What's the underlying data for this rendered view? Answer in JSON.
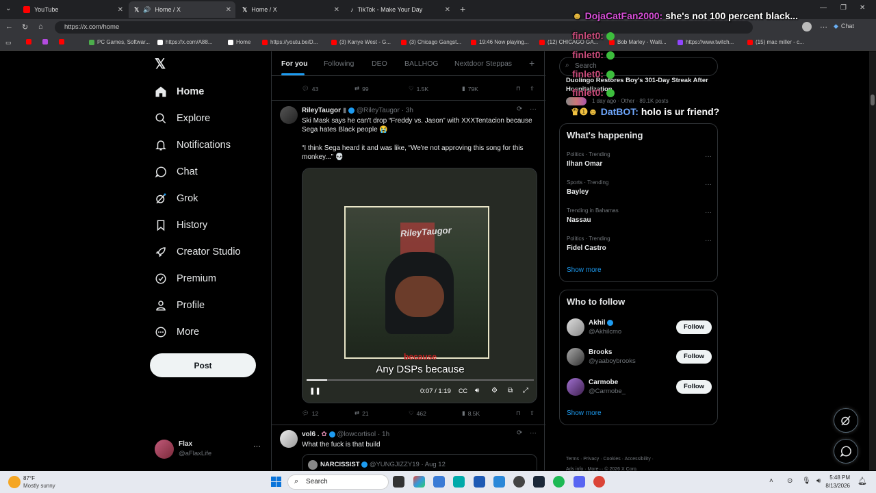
{
  "browser": {
    "tabs": [
      {
        "title": "YouTube",
        "color": "#ff0000"
      },
      {
        "title": "Home / X",
        "color": "#ffffff"
      },
      {
        "title": "Home / X",
        "color": "#ffffff"
      },
      {
        "title": "TikTok - Make Your Day",
        "color": "#ffffff"
      }
    ],
    "url": "https://x.com/home",
    "bookmarks": [
      {
        "label": "",
        "color": "#ff0000"
      },
      {
        "label": "",
        "color": "#b44be0"
      },
      {
        "label": "",
        "color": "#ff0000"
      },
      {
        "label": "PC Games, Softwar...",
        "color": "#4cae4c"
      },
      {
        "label": "https://x.com/A88...",
        "color": "#ffffff"
      },
      {
        "label": "Home",
        "color": "#ffffff"
      },
      {
        "label": "https://youtu.be/D...",
        "color": "#ff0000"
      },
      {
        "label": "(3) Kanye West - G...",
        "color": "#ff0000"
      },
      {
        "label": "(3) Chicago Gangst...",
        "color": "#ff0000"
      },
      {
        "label": "19:46 Now playing...",
        "color": "#ff0000"
      },
      {
        "label": "(12) CHICAGO GA...",
        "color": "#ff0000"
      },
      {
        "label": "Bob Marley - Waiti...",
        "color": "#ff0000"
      },
      {
        "label": "https://www.twitch...",
        "color": "#9146ff"
      },
      {
        "label": "(15) mac miller - c...",
        "color": "#ff0000"
      }
    ],
    "chat_label": "Chat"
  },
  "nav": {
    "items": [
      {
        "label": "Home",
        "icon": "home-icon"
      },
      {
        "label": "Explore",
        "icon": "search-icon"
      },
      {
        "label": "Notifications",
        "icon": "bell-icon"
      },
      {
        "label": "Chat",
        "icon": "chat-icon"
      },
      {
        "label": "Grok",
        "icon": "grok-icon"
      },
      {
        "label": "History",
        "icon": "bookmark-icon"
      },
      {
        "label": "Creator Studio",
        "icon": "rocket-icon"
      },
      {
        "label": "Premium",
        "icon": "verified-icon"
      },
      {
        "label": "Profile",
        "icon": "person-icon"
      },
      {
        "label": "More",
        "icon": "more-circle-icon"
      }
    ],
    "post_label": "Post",
    "profile": {
      "name": "Flax",
      "handle": "@aFlaxLife"
    }
  },
  "feed": {
    "tabs": [
      "For you",
      "Following",
      "DEO",
      "BALLHOG",
      "Nextdoor Steppas"
    ],
    "prev_actions": {
      "replies": "43",
      "reposts": "99",
      "likes": "1.5K",
      "views": "79K"
    },
    "tweet1": {
      "name": "RileyTaugor",
      "handle": "@RileyTaugor",
      "time": "· 3h",
      "text1": "Ski Mask says he can't drop “Freddy vs. Jason” with XXXTentacion because Sega hates Black people 😭",
      "text2": "“I think Sega heard it and was like, “We're not approving this song for this monkey...” 💀",
      "video": {
        "watermark": "RileyTaugor",
        "caption_red": "because",
        "caption": "Any DSPs because",
        "time": "0:07 / 1:19",
        "progress": 0.09
      },
      "actions": {
        "replies": "12",
        "reposts": "21",
        "likes": "462",
        "views": "8.5K"
      }
    },
    "tweet2": {
      "name": "vol6 .",
      "handle": "@lowcortisol",
      "time": "· 1h",
      "text": "What the fuck is that build",
      "quote_name": "NARCISSIST",
      "quote_handle": "@YUNGJIZZY19",
      "quote_time": "· Aug 12"
    }
  },
  "right": {
    "search_placeholder": "Search",
    "news_title": "Duolingo Restores Boy's 301-Day Streak After Hospitalization",
    "news_meta": "1 day ago · Other · 89.1K posts",
    "whats_happening": "What's happening",
    "trends": [
      {
        "category": "Politics · Trending",
        "name": "Ilhan Omar"
      },
      {
        "category": "Sports · Trending",
        "name": "Bayley"
      },
      {
        "category": "Trending in Bahamas",
        "name": "Nassau"
      },
      {
        "category": "Politics · Trending",
        "name": "Fidel Castro"
      }
    ],
    "show_more": "Show more",
    "who_to_follow": "Who to follow",
    "follow": [
      {
        "name": "Akhil",
        "handle": "@Akhilcmo"
      },
      {
        "name": "Brooks",
        "handle": "@yaaboybrooks"
      },
      {
        "name": "Carmobe",
        "handle": "@Carmobe_"
      }
    ],
    "follow_label": "Follow",
    "footer1": "Terms · Privacy · Cookies · Accessibility ·",
    "footer2": "Ads info · More··· © 2026 X Corp."
  },
  "chat_overlay": [
    {
      "user": "DojaCatFan2000:",
      "msg": "she's not 100 percent black..."
    },
    {
      "user": "finlet0:",
      "msg": ""
    },
    {
      "user": "finlet0:",
      "msg": ""
    },
    {
      "user": "finlet0:",
      "msg": ""
    },
    {
      "user": "finlet0:",
      "msg": ""
    },
    {
      "user": "DatBOT:",
      "msg": "holo is ur friend?"
    }
  ],
  "taskbar": {
    "weather_temp": "87°F",
    "weather_desc": "Mostly sunny",
    "search": "Search",
    "time": "5:48 PM",
    "date": "8/13/2026"
  }
}
